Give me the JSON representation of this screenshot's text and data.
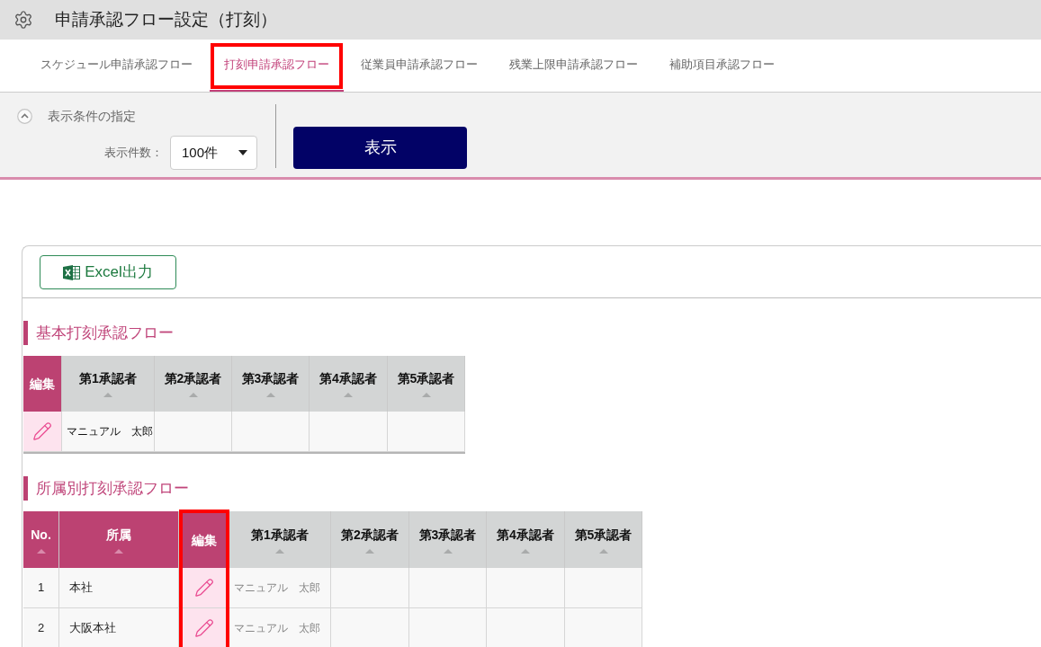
{
  "header": {
    "title": "申請承認フロー設定（打刻）"
  },
  "tabs": [
    {
      "label": "スケジュール申請承認フロー",
      "selected": false,
      "highlighted": false
    },
    {
      "label": "打刻申請承認フロー",
      "selected": true,
      "highlighted": true
    },
    {
      "label": "従業員申請承認フロー",
      "selected": false,
      "highlighted": false
    },
    {
      "label": "残業上限申請承認フロー",
      "selected": false,
      "highlighted": false
    },
    {
      "label": "補助項目承認フロー",
      "selected": false,
      "highlighted": false
    }
  ],
  "filter": {
    "title": "表示条件の指定",
    "expanded": true,
    "count_label": "表示件数：",
    "count_value": "100件",
    "submit_label": "表示"
  },
  "export_button": {
    "label": "Excel出力"
  },
  "sections": [
    {
      "title": "基本打刻承認フロー",
      "table": {
        "names_muted": false,
        "columns": [
          {
            "label": "編集",
            "kind": "edit",
            "sortable": false,
            "highlighted": false
          },
          {
            "label": "第1承認者",
            "kind": "approver",
            "sortable": true,
            "highlighted": false
          },
          {
            "label": "第2承認者",
            "kind": "approver",
            "sortable": true,
            "highlighted": false
          },
          {
            "label": "第3承認者",
            "kind": "approver",
            "sortable": true,
            "highlighted": false
          },
          {
            "label": "第4承認者",
            "kind": "approver",
            "sortable": true,
            "highlighted": false
          },
          {
            "label": "第5承認者",
            "kind": "approver",
            "sortable": true,
            "highlighted": false
          }
        ],
        "rows": [
          {
            "approvers": [
              "マニュアル　太郎"
            ]
          }
        ]
      }
    },
    {
      "title": "所属別打刻承認フロー",
      "table": {
        "names_muted": true,
        "columns": [
          {
            "label": "No.",
            "kind": "no",
            "sortable": true,
            "highlighted": false
          },
          {
            "label": "所属",
            "kind": "department",
            "sortable": true,
            "highlighted": false
          },
          {
            "label": "編集",
            "kind": "edit",
            "sortable": false,
            "highlighted": true
          },
          {
            "label": "第1承認者",
            "kind": "approver",
            "sortable": true,
            "highlighted": false
          },
          {
            "label": "第2承認者",
            "kind": "approver",
            "sortable": true,
            "highlighted": false
          },
          {
            "label": "第3承認者",
            "kind": "approver",
            "sortable": true,
            "highlighted": false
          },
          {
            "label": "第4承認者",
            "kind": "approver",
            "sortable": true,
            "highlighted": false
          },
          {
            "label": "第5承認者",
            "kind": "approver",
            "sortable": true,
            "highlighted": false
          }
        ],
        "rows": [
          {
            "no": "1",
            "department": "本社",
            "approvers": [
              "マニュアル　太郎"
            ]
          },
          {
            "no": "2",
            "department": "大阪本社",
            "approvers": [
              "マニュアル　太郎"
            ]
          }
        ]
      }
    }
  ]
}
